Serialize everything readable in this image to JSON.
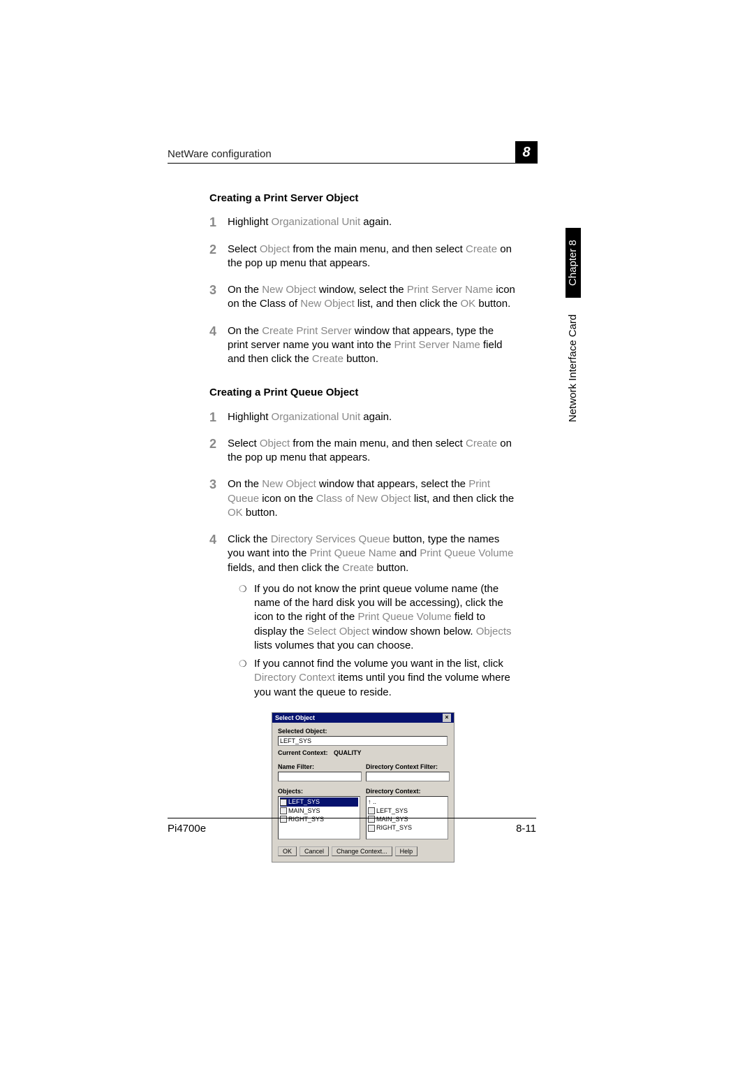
{
  "header": {
    "section_title": "NetWare configuration",
    "chapter_badge": "8"
  },
  "side": {
    "label1": "Chapter 8",
    "label2": "Network Interface Card"
  },
  "section1": {
    "heading": "Creating a Print Server Object",
    "step1a": "Highlight ",
    "step1b": "Organizational Unit",
    "step1c": " again.",
    "step2a": "Select ",
    "step2b": "Object",
    "step2c": " from the main menu, and then select ",
    "step2d": "Create",
    "step2e": " on the pop up menu that appears.",
    "step3a": "On the ",
    "step3b": "New Object",
    "step3c": " window, select the ",
    "step3d": "Print Server Name",
    "step3e": " icon on the Class of ",
    "step3f": "New Object",
    "step3g": " list, and then click the ",
    "step3h": "OK",
    "step3i": " button.",
    "step4a": "On the ",
    "step4b": "Create Print Server",
    "step4c": " window that appears, type the print server name you want into the ",
    "step4d": "Print Server Name",
    "step4e": " field and then click the ",
    "step4f": "Create",
    "step4g": " button."
  },
  "section2": {
    "heading": "Creating a Print Queue Object",
    "step1a": "Highlight ",
    "step1b": "Organizational Unit",
    "step1c": " again.",
    "step2a": "Select ",
    "step2b": "Object",
    "step2c": " from the main menu, and then select ",
    "step2d": "Create",
    "step2e": " on the pop up menu that appears.",
    "step3a": "On the ",
    "step3b": "New Object",
    "step3c": " window that appears, select the ",
    "step3d": "Print Queue",
    "step3e": " icon on the ",
    "step3f": "Class of New Object",
    "step3g": " list, and then click the ",
    "step3h": "OK",
    "step3i": " button.",
    "step4a": "Click the ",
    "step4b": "Directory Services Queue",
    "step4c": " button, type the names you want into the ",
    "step4d": "Print Queue Name",
    "step4e": " and ",
    "step4f": "Print Queue Volume",
    "step4g": " fields, and then click the ",
    "step4h": "Create",
    "step4i": " button.",
    "sub1a": "If you do not know the print queue volume name (the name of the hard disk you will be accessing), click the icon to the right of the ",
    "sub1b": "Print Queue Volume",
    "sub1c": " field to display the ",
    "sub1d": "Select Object",
    "sub1e": " window shown below. ",
    "sub1f": "Objects",
    "sub1g": " lists volumes that you can choose.",
    "sub2a": "If you cannot find the volume you want in the list, click ",
    "sub2b": "Directory Context",
    "sub2c": " items until you find the volume where you want the queue to reside."
  },
  "dialog": {
    "title": "Select Object",
    "selected_object_label": "Selected Object:",
    "selected_object_value": "LEFT_SYS",
    "current_context_label": "Current Context:",
    "current_context_value": "QUALITY",
    "name_filter_label": "Name Filter:",
    "dir_filter_label": "Directory Context Filter:",
    "objects_label": "Objects:",
    "dir_context_label": "Directory Context:",
    "objects_list": [
      "LEFT_SYS",
      "MAIN_SYS",
      "RIGHT_SYS"
    ],
    "dir_context_list": [
      "↑ ..",
      "LEFT_SYS",
      "MAIN_SYS",
      "RIGHT_SYS"
    ],
    "btn_ok": "OK",
    "btn_cancel": "Cancel",
    "btn_change": "Change Context...",
    "btn_help": "Help"
  },
  "footer": {
    "left": "Pi4700e",
    "right": "8-11"
  }
}
